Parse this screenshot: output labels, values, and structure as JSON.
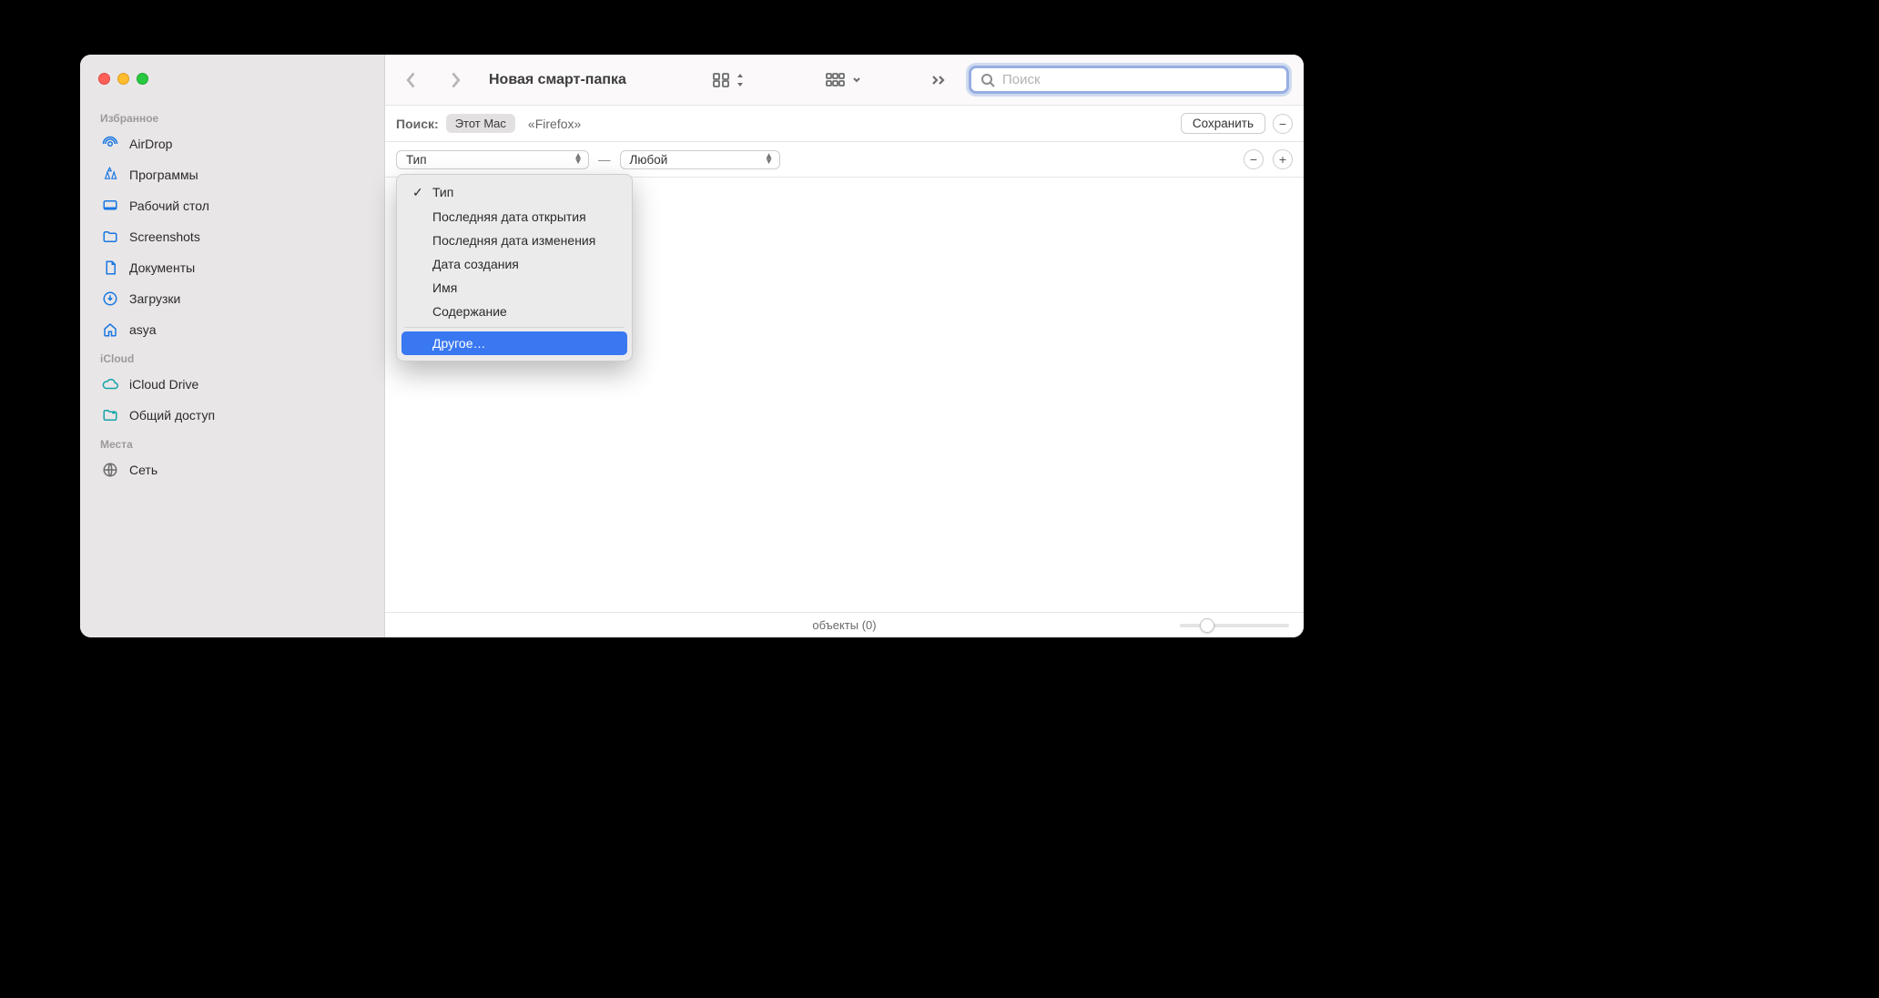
{
  "sidebar": {
    "sections": [
      {
        "label": "Избранное",
        "items": [
          "AirDrop",
          "Программы",
          "Рабочий стол",
          "Screenshots",
          "Документы",
          "Загрузки",
          "asya"
        ]
      },
      {
        "label": "iCloud",
        "items": [
          "iCloud Drive",
          "Общий доступ"
        ]
      },
      {
        "label": "Места",
        "items": [
          "Сеть"
        ]
      }
    ]
  },
  "toolbar": {
    "title": "Новая смарт-папка",
    "search_placeholder": "Поиск"
  },
  "scope": {
    "label": "Поиск:",
    "selected": "Этот Mac",
    "alt": "«Firefox»",
    "save": "Сохранить"
  },
  "criteria": {
    "attribute": "Тип",
    "value": "Любой",
    "menu": [
      "Тип",
      "Последняя дата открытия",
      "Последняя дата изменения",
      "Дата создания",
      "Имя",
      "Содержание"
    ],
    "other": "Другое…",
    "checked_index": 0,
    "highlight_index": 6
  },
  "status": {
    "text": "объекты (0)"
  }
}
